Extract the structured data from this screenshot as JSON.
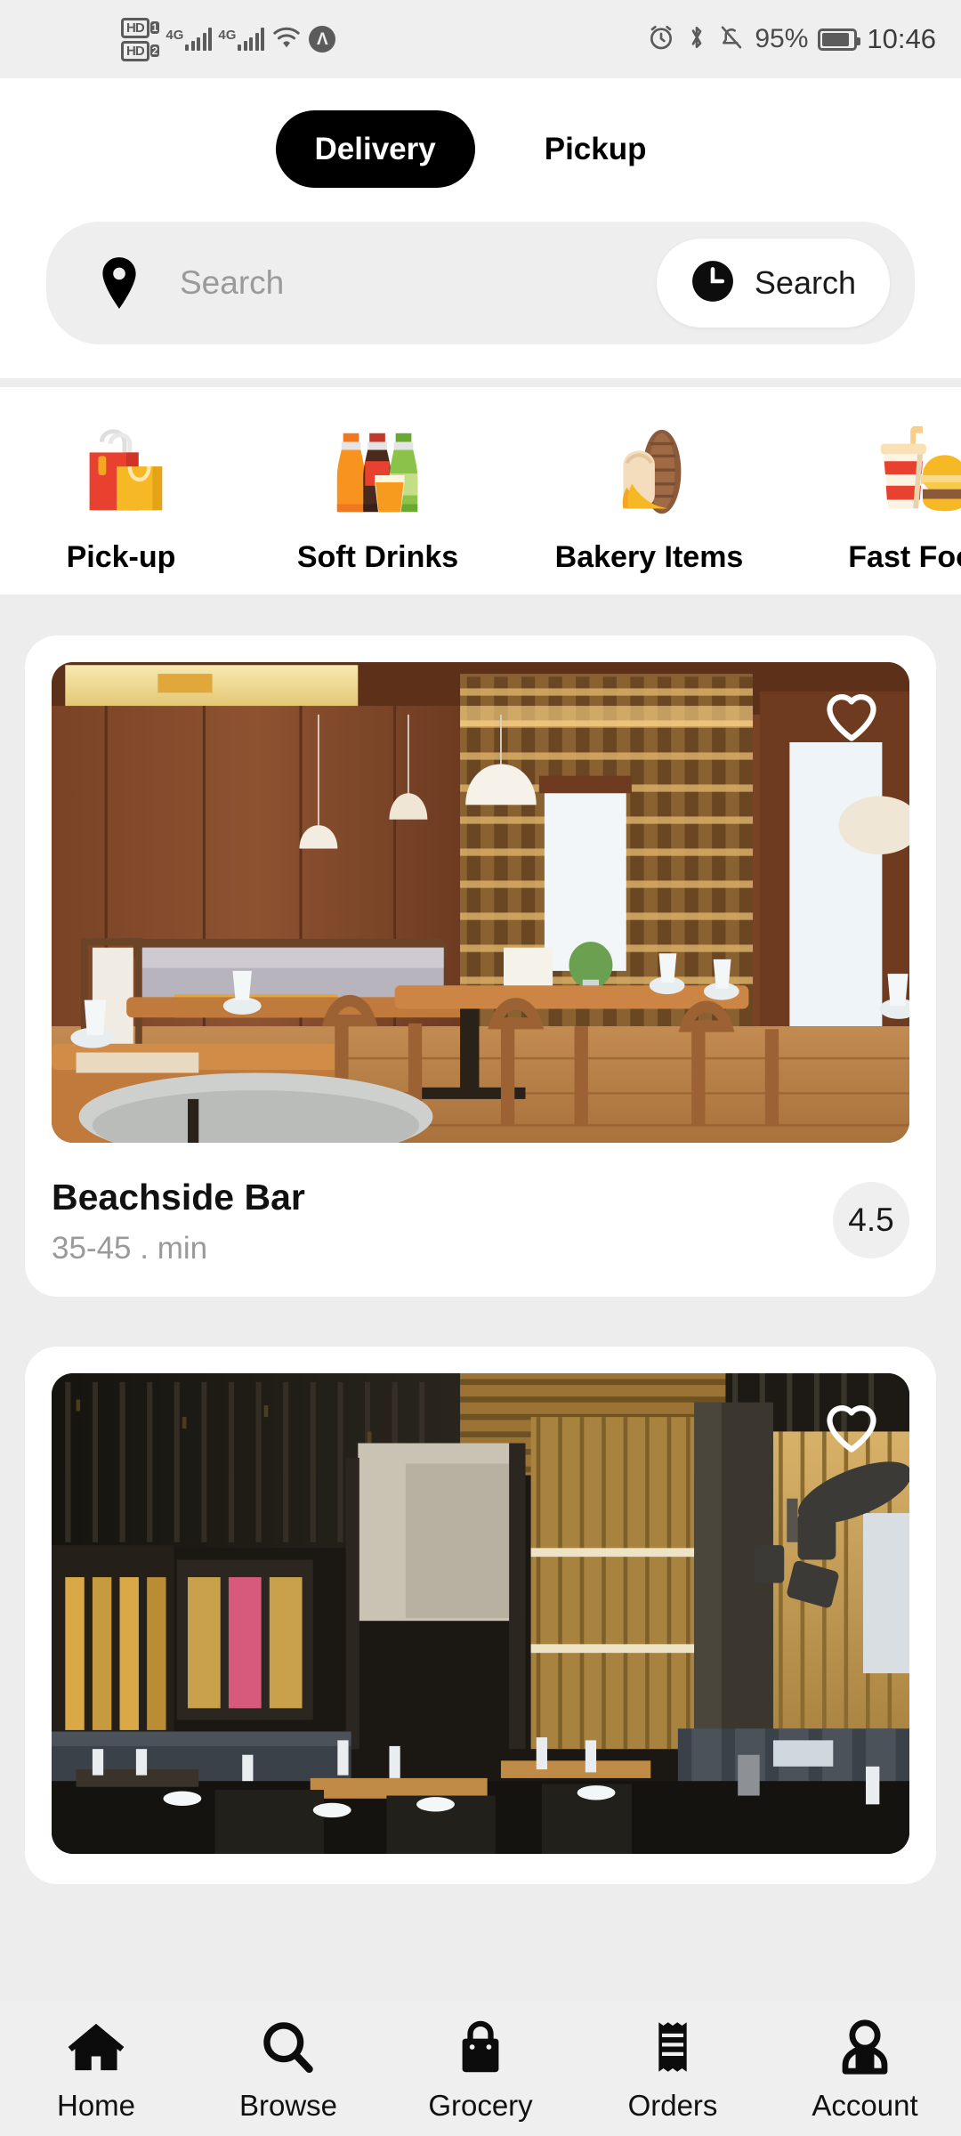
{
  "status_bar": {
    "hd1_label": "HD",
    "hd1_num": "1",
    "hd2_label": "HD",
    "hd2_num": "2",
    "net1": "4G",
    "net2": "4G",
    "battery_percent": "95%",
    "time": "10:46",
    "icons": [
      "wifi-icon",
      "vpn-icon",
      "alarm-icon",
      "bluetooth-icon",
      "mute-icon",
      "battery-icon"
    ]
  },
  "header": {
    "toggle": {
      "delivery_label": "Delivery",
      "pickup_label": "Pickup",
      "active": "Delivery"
    },
    "search": {
      "placeholder": "Search",
      "button_label": "Search",
      "pin_icon": "location-pin-icon",
      "clock_icon": "clock-icon"
    }
  },
  "categories": [
    {
      "label": "Pick-up",
      "icon": "shopping-bags-icon"
    },
    {
      "label": "Soft Drinks",
      "icon": "soda-bottles-icon"
    },
    {
      "label": "Bakery Items",
      "icon": "bread-loaf-icon"
    },
    {
      "label": "Fast Food",
      "icon": "burger-drink-icon"
    }
  ],
  "restaurants": [
    {
      "name": "Beachside Bar",
      "delivery_time": "35-45 . min",
      "rating": "4.5",
      "favorite_icon": "heart-outline-icon",
      "image_alt": "warm-wood-restaurant-interior"
    },
    {
      "name": "",
      "delivery_time": "",
      "rating": "",
      "favorite_icon": "heart-outline-icon",
      "image_alt": "dark-modern-restaurant-interior"
    }
  ],
  "bottom_nav": [
    {
      "label": "Home",
      "icon": "home-icon"
    },
    {
      "label": "Browse",
      "icon": "search-icon"
    },
    {
      "label": "Grocery",
      "icon": "shopping-bag-icon"
    },
    {
      "label": "Orders",
      "icon": "receipt-icon"
    },
    {
      "label": "Account",
      "icon": "person-icon"
    }
  ],
  "colors": {
    "accent": "#000000",
    "page_bg": "#ededed",
    "card_bg": "#ffffff",
    "muted_text": "#9a9a9a"
  }
}
